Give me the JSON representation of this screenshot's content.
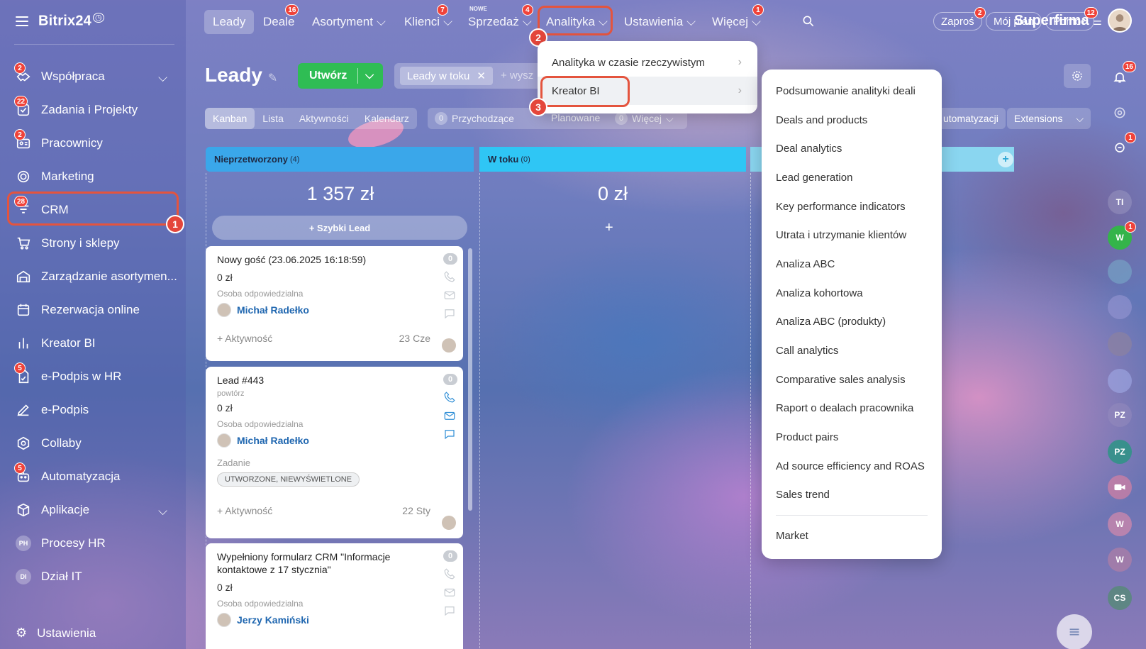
{
  "sidebar": {
    "logo": "Bitrix24",
    "items": [
      {
        "label": "Współpraca",
        "badge": "2",
        "icon": "handshake-icon"
      },
      {
        "label": "Zadania i Projekty",
        "badge": "22",
        "icon": "checkbox-icon"
      },
      {
        "label": "Pracownicy",
        "badge": "2",
        "icon": "id-card-icon"
      },
      {
        "label": "Marketing",
        "badge": "",
        "icon": "target-icon"
      },
      {
        "label": "CRM",
        "badge": "28",
        "icon": "funnel-icon"
      },
      {
        "label": "Strony i sklepy",
        "badge": "",
        "icon": "cart-icon"
      },
      {
        "label": "Zarządzanie asortymen...",
        "badge": "",
        "icon": "warehouse-icon"
      },
      {
        "label": "Rezerwacja online",
        "badge": "",
        "icon": "calendar-icon"
      },
      {
        "label": "Kreator BI",
        "badge": "",
        "icon": "bar-chart-icon"
      },
      {
        "label": "e-Podpis w HR",
        "badge": "5",
        "icon": "document-sign-icon"
      },
      {
        "label": "e-Podpis",
        "badge": "",
        "icon": "pen-icon"
      },
      {
        "label": "Collaby",
        "badge": "",
        "icon": "hexagon-icon"
      },
      {
        "label": "Automatyzacja",
        "badge": "5",
        "icon": "robot-icon"
      },
      {
        "label": "Aplikacje",
        "badge": "",
        "icon": "cube-icon"
      },
      {
        "label": "Procesy HR",
        "badge": "",
        "icon": "PH"
      },
      {
        "label": "Dział IT",
        "badge": "",
        "icon": "DI"
      }
    ],
    "settings": "Ustawienia"
  },
  "steps": [
    "1",
    "2",
    "3"
  ],
  "topbar": {
    "tabs": [
      {
        "label": "Leady",
        "badge": ""
      },
      {
        "label": "Deale",
        "badge": "16"
      },
      {
        "label": "Asortyment",
        "badge": ""
      },
      {
        "label": "Klienci",
        "badge": "7"
      },
      {
        "label": "Sprzedaż",
        "badge": "4",
        "tag": "NOWE"
      },
      {
        "label": "Analityka",
        "badge": ""
      },
      {
        "label": "Ustawienia",
        "badge": ""
      },
      {
        "label": "Więcej",
        "badge": "1"
      }
    ],
    "company": "Superfirma",
    "invite": "Zaproś",
    "invite_badge": "2",
    "plan": "Mój plan",
    "help": "Pomoc",
    "help_badge": "12"
  },
  "header": {
    "title": "Leady",
    "create": "Utwórz",
    "filter_chip": "Leady w toku",
    "filter_placeholder": "+ wysz"
  },
  "views": [
    "Kanban",
    "Lista",
    "Aktywności",
    "Kalendarz"
  ],
  "counters": [
    {
      "n": "0",
      "label": "Przychodzące"
    },
    {
      "n": "",
      "label": "Planowane"
    },
    {
      "n": "0",
      "label": "Więcej"
    }
  ],
  "right_tools": {
    "automation": "utomatyzacji",
    "extensions": "Extensions"
  },
  "columns": [
    {
      "title": "Nieprzetworzony",
      "count": "(4)",
      "sum": "1 357 zł",
      "color": "#3aa7ea"
    },
    {
      "title": "W toku",
      "count": "(0)",
      "sum": "0 zł",
      "color": "#2fc6f5"
    }
  ],
  "quick_lead": "+ Szybki Lead",
  "cards": [
    {
      "title": "Nowy gość (23.06.2025 16:18:59)",
      "sub": "",
      "sum": "0 zł",
      "resp_label": "Osoba odpowiedzialna",
      "user": "Michał Radełko",
      "activity": "+ Aktywność",
      "date": "23 Cze",
      "count": "0"
    },
    {
      "title": "Lead #443",
      "sub": "powtórz",
      "sum": "0 zł",
      "resp_label": "Osoba odpowiedzialna",
      "user": "Michał Radełko",
      "task_label": "Zadanie",
      "tag": "UTWORZONE, NIEWYŚWIETLONE",
      "activity": "+ Aktywność",
      "date": "22 Sty",
      "count": "0"
    },
    {
      "title": "Wypełniony formularz CRM \"Informacje kontaktowe z 17 stycznia\"",
      "sum": "0 zł",
      "resp_label": "Osoba odpowiedzialna",
      "user": "Jerzy Kamiński",
      "count": "0"
    }
  ],
  "analytics_menu": [
    {
      "label": "Analityka w czasie rzeczywistym"
    },
    {
      "label": "Kreator BI"
    }
  ],
  "bi_menu": [
    "Podsumowanie analityki deali",
    "Deals and products",
    "Deal analytics",
    "Lead generation",
    "Key performance indicators",
    "Utrata i utrzymanie klientów",
    "Analiza ABC",
    "Analiza kohortowa",
    "Analiza ABC (produkty)",
    "Call analytics",
    "Comparative sales analysis",
    "Raport o dealach pracownika",
    "Product pairs",
    "Ad source efficiency and ROAS",
    "Sales trend"
  ],
  "bi_menu_footer": "Market",
  "rail": [
    {
      "label": "",
      "badge": "16",
      "icon": "bell-icon"
    },
    {
      "label": "",
      "badge": "",
      "icon": "target-icon"
    },
    {
      "label": "",
      "badge": "1",
      "icon": "chat-icon"
    },
    {
      "label": "TI",
      "badge": ""
    },
    {
      "label": "W",
      "badge": "1"
    },
    {
      "label": "",
      "badge": ""
    },
    {
      "label": "",
      "badge": ""
    },
    {
      "label": "",
      "badge": ""
    },
    {
      "label": "",
      "badge": ""
    },
    {
      "label": "PZ",
      "badge": ""
    },
    {
      "label": "PZ",
      "badge": ""
    },
    {
      "label": "",
      "badge": "",
      "icon": "video-icon"
    },
    {
      "label": "W",
      "badge": ""
    },
    {
      "label": "W",
      "badge": ""
    },
    {
      "label": "CS",
      "badge": ""
    }
  ]
}
